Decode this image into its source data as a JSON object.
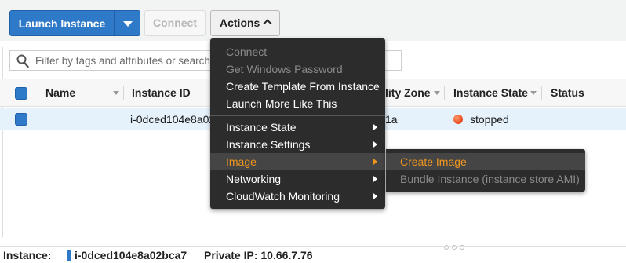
{
  "toolbar": {
    "launch_label": "Launch Instance",
    "connect_label": "Connect",
    "actions_label": "Actions"
  },
  "filter": {
    "placeholder": "Filter by tags and attributes or search by keyword"
  },
  "table": {
    "columns": [
      "Name",
      "Instance ID",
      "Availability Zone",
      "Instance State",
      "Status Checks"
    ],
    "visible_headers": {
      "name": "Name",
      "instance_id": "Instance ID",
      "availability_zone_partial": "lity Zone",
      "instance_state": "Instance State",
      "status_checks": "Status Checks"
    },
    "rows": [
      {
        "name": "",
        "instance_id_partial": "i-0dced104e8a02",
        "availability_zone_partial": "1a",
        "state": "stopped"
      }
    ]
  },
  "actions_menu": {
    "items": [
      {
        "label": "Connect",
        "disabled": true
      },
      {
        "label": "Get Windows Password",
        "disabled": true
      },
      {
        "label": "Create Template From Instance",
        "disabled": false
      },
      {
        "label": "Launch More Like This",
        "disabled": false
      },
      {
        "label": "Instance State",
        "submenu": true
      },
      {
        "label": "Instance Settings",
        "submenu": true
      },
      {
        "label": "Image",
        "submenu": true,
        "highlighted": true
      },
      {
        "label": "Networking",
        "submenu": true
      },
      {
        "label": "CloudWatch Monitoring",
        "submenu": true
      }
    ]
  },
  "image_submenu": {
    "items": [
      {
        "label": "Create Image",
        "highlighted": true
      },
      {
        "label": "Bundle Instance (instance store AMI)",
        "disabled": true
      }
    ]
  },
  "details": {
    "instance_label": "Instance:",
    "instance_id": "i-0dced104e8a02bca7",
    "private_ip": "Private IP: 10.66.7.76"
  },
  "colors": {
    "primary_blue": "#2f79c9",
    "menu_bg": "#2c2c2c",
    "menu_highlight_text": "#f0961e",
    "stopped_status": "#e8461a"
  }
}
